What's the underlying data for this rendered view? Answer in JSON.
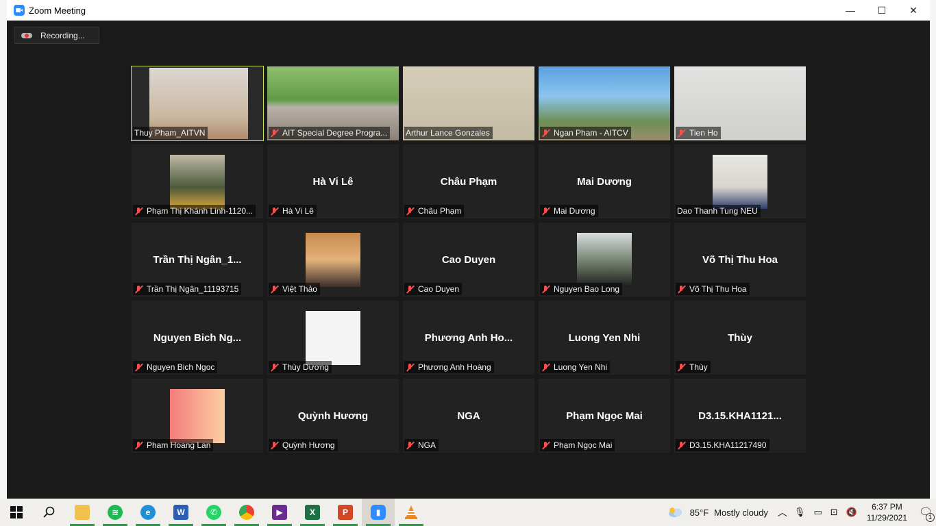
{
  "window": {
    "title": "Zoom Meeting",
    "controls": [
      "—",
      "☐",
      "✕"
    ]
  },
  "recording": {
    "label": "Recording..."
  },
  "tiles": [
    {
      "name": "Thuy Pham_AITVN",
      "kind": "video",
      "muted": false,
      "active": true
    },
    {
      "name": "AIT Special Degree Progra...",
      "kind": "video",
      "muted": true
    },
    {
      "name": "Arthur Lance Gonzales",
      "kind": "video",
      "muted": false
    },
    {
      "name": "Ngan Pham - AITCV",
      "kind": "video",
      "muted": true
    },
    {
      "name": "Tien Ho",
      "kind": "video",
      "muted": true
    },
    {
      "name": "Phạm Thị Khánh Linh-1120...",
      "kind": "avatar",
      "muted": true
    },
    {
      "name": "Hà Vi Lê",
      "kind": "text",
      "display": "Hà Vi Lê",
      "muted": true
    },
    {
      "name": "Châu Phạm",
      "kind": "text",
      "display": "Châu Phạm",
      "muted": true
    },
    {
      "name": "Mai Dương",
      "kind": "text",
      "display": "Mai Dương",
      "muted": true
    },
    {
      "name": "Dao Thanh Tung NEU",
      "kind": "avatar",
      "muted": false
    },
    {
      "name": "Trần Thị Ngân_11193715",
      "kind": "text",
      "display": "Trần Thị Ngân_1...",
      "muted": true
    },
    {
      "name": "Việt Thảo",
      "kind": "avatar",
      "muted": true
    },
    {
      "name": "Cao Duyen",
      "kind": "text",
      "display": "Cao Duyen",
      "muted": true
    },
    {
      "name": "Nguyen Bao Long",
      "kind": "avatar",
      "muted": true
    },
    {
      "name": "Võ Thị Thu Hoa",
      "kind": "text",
      "display": "Võ Thị Thu Hoa",
      "muted": true
    },
    {
      "name": "Nguyen Bich Ngoc",
      "kind": "text",
      "display": "Nguyen Bich Ng...",
      "muted": true
    },
    {
      "name": "Thùy Dương",
      "kind": "avatar",
      "muted": true
    },
    {
      "name": "Phương Anh Hoàng",
      "kind": "text",
      "display": "Phương Anh Ho...",
      "muted": true
    },
    {
      "name": "Luong Yen Nhi",
      "kind": "text",
      "display": "Luong Yen Nhi",
      "muted": true
    },
    {
      "name": "Thùy",
      "kind": "text",
      "display": "Thùy",
      "muted": true
    },
    {
      "name": "Pham Hoang Lan",
      "kind": "avatar",
      "muted": true
    },
    {
      "name": "Quỳnh Hương",
      "kind": "text",
      "display": "Quỳnh Hương",
      "muted": true
    },
    {
      "name": "NGA",
      "kind": "text",
      "display": "NGA",
      "muted": true
    },
    {
      "name": "Phạm Ngọc Mai",
      "kind": "text",
      "display": "Phạm Ngọc Mai",
      "muted": true
    },
    {
      "name": "D3.15.KHA11217490",
      "kind": "text",
      "display": "D3.15.KHA1121...",
      "muted": true
    }
  ],
  "taskbar": {
    "apps": [
      "start",
      "search",
      "file-explorer",
      "spotify",
      "edge",
      "word",
      "whatsapp",
      "chrome",
      "visual-studio",
      "excel",
      "powerpoint",
      "zoom",
      "vlc"
    ],
    "weather": {
      "temp": "85°F",
      "text": "Mostly cloudy"
    },
    "clock": {
      "time": "6:37 PM",
      "date": "11/29/2021"
    },
    "notifications": "1"
  }
}
